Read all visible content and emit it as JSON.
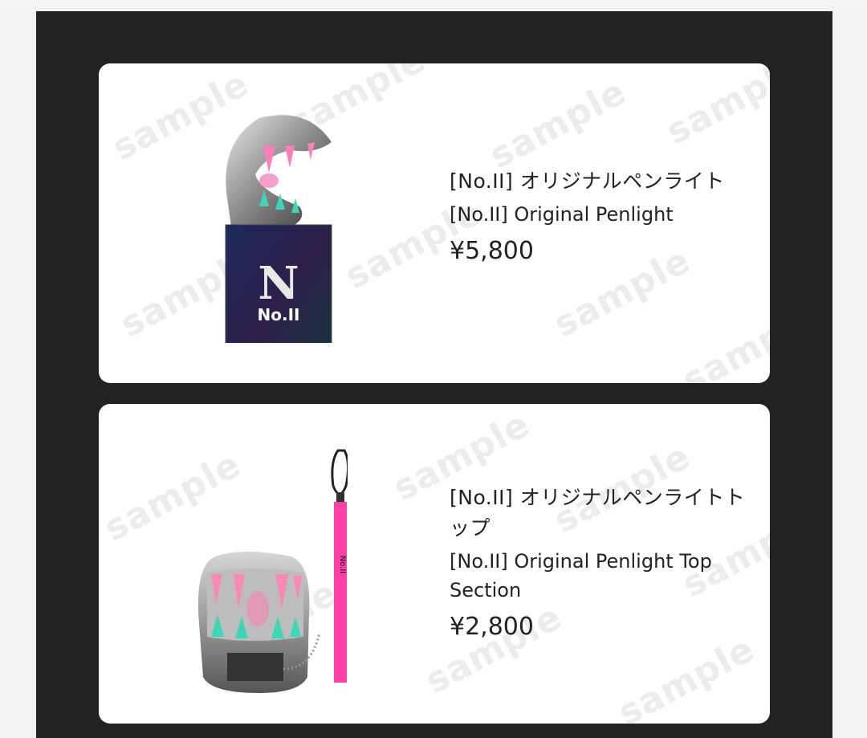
{
  "products": [
    {
      "name_ja": "[No.II] オリジナルペンライト",
      "name_en": "[No.II] Original Penlight",
      "price": "¥5,800",
      "image_label": "No.II"
    },
    {
      "name_ja": "[No.II] オリジナルペンライトトップ",
      "name_en": "[No.II] Original Penlight Top Section",
      "price": "¥2,800",
      "image_label": "No.II"
    }
  ],
  "watermark": "sample",
  "colors": {
    "background": "#222222",
    "card": "#ffffff",
    "accent_pink": "#ff3fa8",
    "accent_teal": "#3fd6b5"
  }
}
